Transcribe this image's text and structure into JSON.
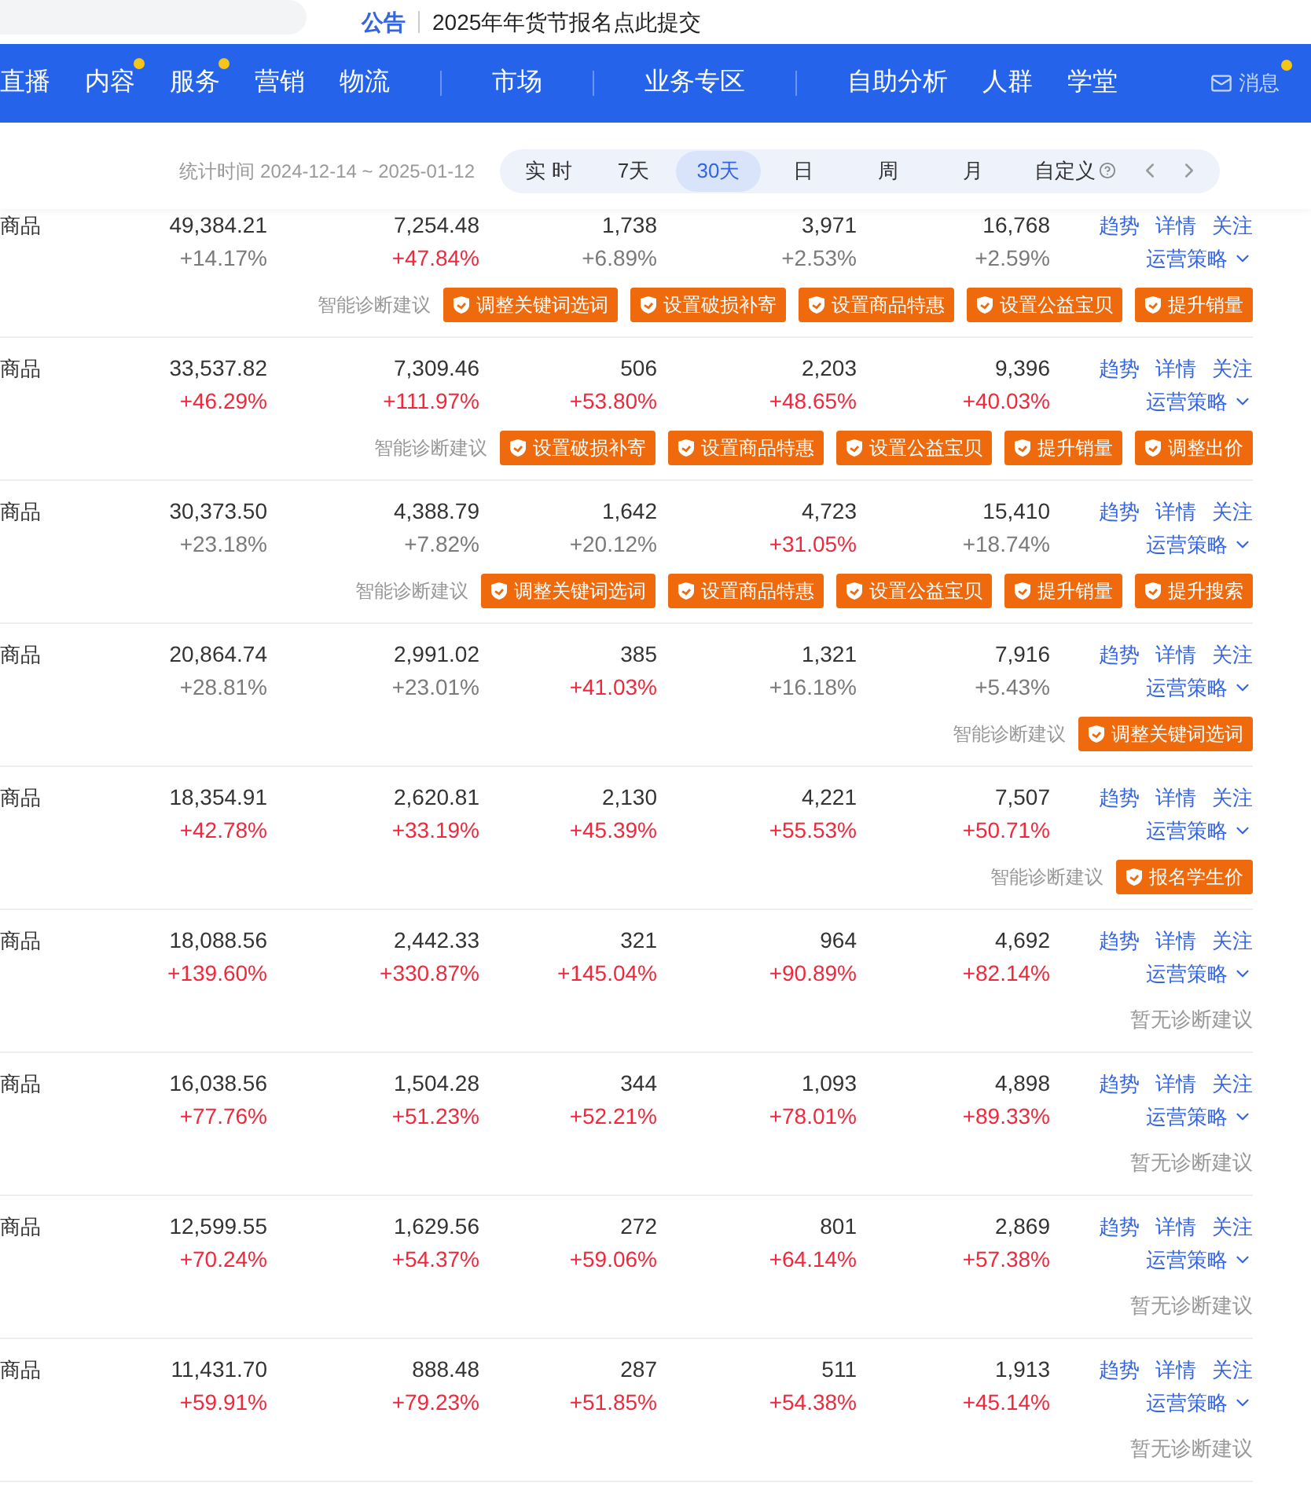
{
  "announcement": {
    "label": "公告",
    "text": "2025年年货节报名点此提交"
  },
  "nav": {
    "items": [
      {
        "label": "直播",
        "dot": false,
        "divider_before": false
      },
      {
        "label": "内容",
        "dot": true,
        "divider_before": false
      },
      {
        "label": "服务",
        "dot": true,
        "divider_before": false
      },
      {
        "label": "营销",
        "dot": false,
        "divider_before": false
      },
      {
        "label": "物流",
        "dot": false,
        "divider_before": false
      },
      {
        "label": "市场",
        "dot": false,
        "divider_before": true
      },
      {
        "label": "业务专区",
        "dot": false,
        "divider_before": true
      },
      {
        "label": "自助分析",
        "dot": false,
        "divider_before": true
      },
      {
        "label": "人群",
        "dot": false,
        "divider_before": false
      },
      {
        "label": "学堂",
        "dot": false,
        "divider_before": false
      }
    ],
    "messages": {
      "label": "消息",
      "dot": true
    }
  },
  "filter": {
    "period_label": "统计时间 2024-12-14 ~ 2025-01-12",
    "options": [
      {
        "label": "实 时",
        "selected": false
      },
      {
        "label": "7天",
        "selected": false
      },
      {
        "label": "30天",
        "selected": true
      },
      {
        "label": "日",
        "selected": false
      },
      {
        "label": "周",
        "selected": false
      },
      {
        "label": "月",
        "selected": false
      },
      {
        "label": "自定义",
        "selected": false
      }
    ]
  },
  "rows": [
    {
      "name": "商品",
      "cells": [
        {
          "value": "49,384.21",
          "change": "+14.17%",
          "highlight": false
        },
        {
          "value": "7,254.48",
          "change": "+47.84%",
          "highlight": true
        },
        {
          "value": "1,738",
          "change": "+6.89%",
          "highlight": false
        },
        {
          "value": "3,971",
          "change": "+2.53%",
          "highlight": false
        },
        {
          "value": "16,768",
          "change": "+2.59%",
          "highlight": false
        }
      ],
      "links": [
        "趋势",
        "详情",
        "关注"
      ],
      "strategy": "运营策略",
      "diagnosis_label": "智能诊断建议",
      "suggestions": [
        "调整关键词选词",
        "设置破损补寄",
        "设置商品特惠",
        "设置公益宝贝",
        "提升销量"
      ]
    },
    {
      "name": "商品",
      "cells": [
        {
          "value": "33,537.82",
          "change": "+46.29%",
          "highlight": true
        },
        {
          "value": "7,309.46",
          "change": "+111.97%",
          "highlight": true
        },
        {
          "value": "506",
          "change": "+53.80%",
          "highlight": true
        },
        {
          "value": "2,203",
          "change": "+48.65%",
          "highlight": true
        },
        {
          "value": "9,396",
          "change": "+40.03%",
          "highlight": true
        }
      ],
      "links": [
        "趋势",
        "详情",
        "关注"
      ],
      "strategy": "运营策略",
      "diagnosis_label": "智能诊断建议",
      "suggestions": [
        "设置破损补寄",
        "设置商品特惠",
        "设置公益宝贝",
        "提升销量",
        "调整出价"
      ]
    },
    {
      "name": "商品",
      "cells": [
        {
          "value": "30,373.50",
          "change": "+23.18%",
          "highlight": false
        },
        {
          "value": "4,388.79",
          "change": "+7.82%",
          "highlight": false
        },
        {
          "value": "1,642",
          "change": "+20.12%",
          "highlight": false
        },
        {
          "value": "4,723",
          "change": "+31.05%",
          "highlight": true
        },
        {
          "value": "15,410",
          "change": "+18.74%",
          "highlight": false
        }
      ],
      "links": [
        "趋势",
        "详情",
        "关注"
      ],
      "strategy": "运营策略",
      "diagnosis_label": "智能诊断建议",
      "suggestions": [
        "调整关键词选词",
        "设置商品特惠",
        "设置公益宝贝",
        "提升销量",
        "提升搜索"
      ]
    },
    {
      "name": "商品",
      "cells": [
        {
          "value": "20,864.74",
          "change": "+28.81%",
          "highlight": false
        },
        {
          "value": "2,991.02",
          "change": "+23.01%",
          "highlight": false
        },
        {
          "value": "385",
          "change": "+41.03%",
          "highlight": true
        },
        {
          "value": "1,321",
          "change": "+16.18%",
          "highlight": false
        },
        {
          "value": "7,916",
          "change": "+5.43%",
          "highlight": false
        }
      ],
      "links": [
        "趋势",
        "详情",
        "关注"
      ],
      "strategy": "运营策略",
      "diagnosis_label": "智能诊断建议",
      "suggestions": [
        "调整关键词选词"
      ]
    },
    {
      "name": "商品",
      "cells": [
        {
          "value": "18,354.91",
          "change": "+42.78%",
          "highlight": true
        },
        {
          "value": "2,620.81",
          "change": "+33.19%",
          "highlight": true
        },
        {
          "value": "2,130",
          "change": "+45.39%",
          "highlight": true
        },
        {
          "value": "4,221",
          "change": "+55.53%",
          "highlight": true
        },
        {
          "value": "7,507",
          "change": "+50.71%",
          "highlight": true
        }
      ],
      "links": [
        "趋势",
        "详情",
        "关注"
      ],
      "strategy": "运营策略",
      "diagnosis_label": "智能诊断建议",
      "suggestions": [
        "报名学生价"
      ]
    },
    {
      "name": "商品",
      "cells": [
        {
          "value": "18,088.56",
          "change": "+139.60%",
          "highlight": true
        },
        {
          "value": "2,442.33",
          "change": "+330.87%",
          "highlight": true
        },
        {
          "value": "321",
          "change": "+145.04%",
          "highlight": true
        },
        {
          "value": "964",
          "change": "+90.89%",
          "highlight": true
        },
        {
          "value": "4,692",
          "change": "+82.14%",
          "highlight": true
        }
      ],
      "links": [
        "趋势",
        "详情",
        "关注"
      ],
      "strategy": "运营策略",
      "no_diagnosis": "暂无诊断建议"
    },
    {
      "name": "商品",
      "cells": [
        {
          "value": "16,038.56",
          "change": "+77.76%",
          "highlight": true
        },
        {
          "value": "1,504.28",
          "change": "+51.23%",
          "highlight": true
        },
        {
          "value": "344",
          "change": "+52.21%",
          "highlight": true
        },
        {
          "value": "1,093",
          "change": "+78.01%",
          "highlight": true
        },
        {
          "value": "4,898",
          "change": "+89.33%",
          "highlight": true
        }
      ],
      "links": [
        "趋势",
        "详情",
        "关注"
      ],
      "strategy": "运营策略",
      "no_diagnosis": "暂无诊断建议"
    },
    {
      "name": "商品",
      "cells": [
        {
          "value": "12,599.55",
          "change": "+70.24%",
          "highlight": true
        },
        {
          "value": "1,629.56",
          "change": "+54.37%",
          "highlight": true
        },
        {
          "value": "272",
          "change": "+59.06%",
          "highlight": true
        },
        {
          "value": "801",
          "change": "+64.14%",
          "highlight": true
        },
        {
          "value": "2,869",
          "change": "+57.38%",
          "highlight": true
        }
      ],
      "links": [
        "趋势",
        "详情",
        "关注"
      ],
      "strategy": "运营策略",
      "no_diagnosis": "暂无诊断建议"
    },
    {
      "name": "商品",
      "cells": [
        {
          "value": "11,431.70",
          "change": "+59.91%",
          "highlight": true
        },
        {
          "value": "888.48",
          "change": "+79.23%",
          "highlight": true
        },
        {
          "value": "287",
          "change": "+51.85%",
          "highlight": true
        },
        {
          "value": "511",
          "change": "+54.38%",
          "highlight": true
        },
        {
          "value": "1,913",
          "change": "+45.14%",
          "highlight": true
        }
      ],
      "links": [
        "趋势",
        "详情",
        "关注"
      ],
      "strategy": "运营策略",
      "no_diagnosis": "暂无诊断建议"
    }
  ]
}
